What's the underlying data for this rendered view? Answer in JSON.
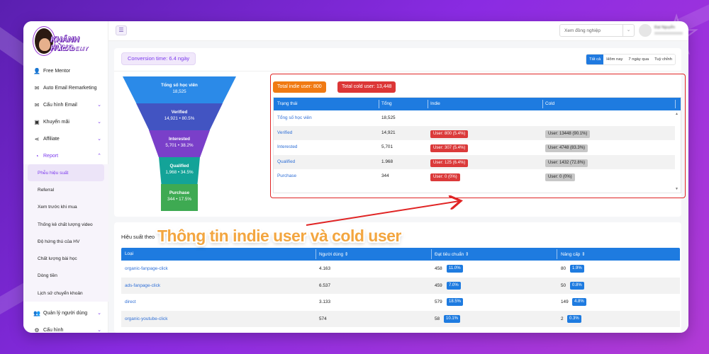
{
  "brand": {
    "line1": "KHÁNH HÙNG",
    "line2": "ACADEMY"
  },
  "sidebar": {
    "items": [
      {
        "label": "Free Mentor",
        "icon": "person-icon"
      },
      {
        "label": "Auto Email Remarketing",
        "icon": "email-icon"
      },
      {
        "label": "Cấu hình Email",
        "icon": "email-settings-icon",
        "chevron": "⌄"
      },
      {
        "label": "Khuyến mãi",
        "icon": "gift-icon",
        "chevron": "⌄"
      },
      {
        "label": "Affiliate",
        "icon": "share-icon",
        "chevron": "⌄"
      },
      {
        "label": "Report",
        "icon": "chart-icon",
        "chevron": "⌃"
      }
    ],
    "report_sub": [
      "Phễu hiệu suất",
      "Referral",
      "Xem trước khi mua",
      "Thống kê chất lượng video",
      "Độ hứng thú của HV",
      "Chất lượng bài học",
      "Dòng tiền",
      "Lịch sử chuyển khoản"
    ],
    "bottom": [
      {
        "label": "Quản lý người dùng",
        "icon": "users-icon",
        "chevron": "⌄"
      },
      {
        "label": "Cấu hình",
        "icon": "gear-icon",
        "chevron": "⌄"
      }
    ]
  },
  "topbar": {
    "menu_icon": "☰",
    "select_placeholder": "Xem đồng nghiệp",
    "select_arrow": "⌄",
    "user_name": "Đạt Nguyễn"
  },
  "conversion_time": "Conversion time: 6.4 ngày",
  "filters": [
    "Tất cả",
    "Hôm nay",
    "7 ngày qua",
    "Tuỳ chỉnh"
  ],
  "funnel": [
    {
      "label": "Tổng số học viên",
      "value": "18,525",
      "color": "#2b8ae8"
    },
    {
      "label": "Verified",
      "value": "14,921 • 80.5%",
      "color": "#4254c2"
    },
    {
      "label": "Interested",
      "value": "5,701 • 38.2%",
      "color": "#7a3fc9"
    },
    {
      "label": "Qualified",
      "value": "1,968 • 34.5%",
      "color": "#13a398"
    },
    {
      "label": "Purchase",
      "value": "344 • 17.5%",
      "color": "#3eaa52"
    }
  ],
  "totals": {
    "indie": "Total indie user: 800",
    "cold": "Total cold user: 13,448"
  },
  "status_table": {
    "headers": [
      "Trạng thái",
      "Tổng",
      "Indie",
      "Cold"
    ],
    "rows": [
      {
        "status": "Tổng số học viên",
        "total": "18,525",
        "indie": "",
        "cold": ""
      },
      {
        "status": "Verified",
        "total": "14,921",
        "indie": "User: 800 (5.4%)",
        "cold": "User: 13448 (90.1%)"
      },
      {
        "status": "Interested",
        "total": "5,701",
        "indie": "User: 307 (5.4%)",
        "cold": "User: 4748 (83.3%)"
      },
      {
        "status": "Qualified",
        "total": "1.968",
        "indie": "User: 125 (6.4%)",
        "cold": "User: 1432 (72.8%)"
      },
      {
        "status": "Purchase",
        "total": "344",
        "indie": "User: 0 (0%)",
        "cold": "User: 0 (0%)"
      }
    ]
  },
  "performance": {
    "title": "Hiệu suất theo",
    "headers": [
      "Loại",
      "Người dùng ⇕",
      "Đạt tiêu chuẩn ⇕",
      "Nâng cấp ⇕"
    ],
    "rows": [
      {
        "type": "organic-fanpage-click",
        "users": "4.163",
        "std": "458",
        "std_pct": "11.0%",
        "up": "80",
        "up_pct": "1.9%"
      },
      {
        "type": "ads-fanpage-click",
        "users": "6.537",
        "std": "459",
        "std_pct": "7.0%",
        "up": "50",
        "up_pct": "0.8%"
      },
      {
        "type": "direct",
        "users": "3.133",
        "std": "579",
        "std_pct": "18.5%",
        "up": "149",
        "up_pct": "4.8%"
      },
      {
        "type": "organic-youtube-click",
        "users": "574",
        "std": "58",
        "std_pct": "10.1%",
        "up": "2",
        "up_pct": "0.3%"
      }
    ]
  },
  "annotation": "Thông tin indie user và cold user"
}
